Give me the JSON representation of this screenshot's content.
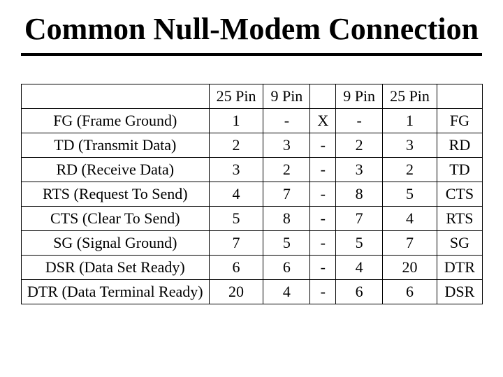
{
  "title": "Common Null-Modem Connection",
  "headers": {
    "c1": "",
    "c2": "25 Pin",
    "c3": "9 Pin",
    "c4": "",
    "c5": "9 Pin",
    "c6": "25 Pin",
    "c7": ""
  },
  "rows": [
    {
      "left": "FG (Frame Ground)",
      "p25a": "1",
      "p9a": "-",
      "link": "X",
      "p9b": "-",
      "p25b": "1",
      "right": "FG"
    },
    {
      "left": "TD (Transmit Data)",
      "p25a": "2",
      "p9a": "3",
      "link": "-",
      "p9b": "2",
      "p25b": "3",
      "right": "RD"
    },
    {
      "left": "RD (Receive Data)",
      "p25a": "3",
      "p9a": "2",
      "link": "-",
      "p9b": "3",
      "p25b": "2",
      "right": "TD"
    },
    {
      "left": "RTS (Request To Send)",
      "p25a": "4",
      "p9a": "7",
      "link": "-",
      "p9b": "8",
      "p25b": "5",
      "right": "CTS"
    },
    {
      "left": "CTS (Clear To Send)",
      "p25a": "5",
      "p9a": "8",
      "link": "-",
      "p9b": "7",
      "p25b": "4",
      "right": "RTS"
    },
    {
      "left": "SG (Signal Ground)",
      "p25a": "7",
      "p9a": "5",
      "link": "-",
      "p9b": "5",
      "p25b": "7",
      "right": "SG"
    },
    {
      "left": "DSR (Data Set Ready)",
      "p25a": "6",
      "p9a": "6",
      "link": "-",
      "p9b": "4",
      "p25b": "20",
      "right": "DTR"
    },
    {
      "left": "DTR (Data Terminal Ready)",
      "p25a": "20",
      "p9a": "4",
      "link": "-",
      "p9b": "6",
      "p25b": "6",
      "right": "DSR"
    }
  ]
}
